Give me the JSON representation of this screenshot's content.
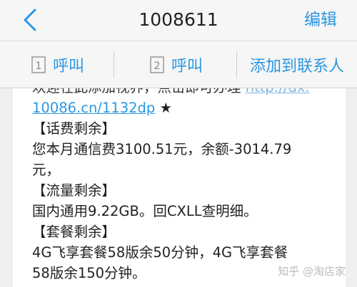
{
  "header": {
    "title": "1008611",
    "edit_label": "编辑"
  },
  "actions": {
    "call1": {
      "sim_number": "1",
      "label": "呼叫"
    },
    "call2": {
      "sim_number": "2",
      "label": "呼叫"
    },
    "add_contact": "添加到联系人"
  },
  "message": {
    "partial_top_text": "欢迎在此添加视界，点击即可办理",
    "partial_top_link": "http://dx.",
    "link_text": "10086.cn/1132dp",
    "star": " ★",
    "lines": [
      "【话费剩余】",
      "您本月通信费3100.51元，余额-3014.79",
      "元，",
      "【流量剩余】",
      "国内通用9.22GB。回CXLL查明细。",
      "【套餐剩余】",
      "4G飞享套餐58版余50分钟，4G飞享套餐",
      "58版余150分钟。"
    ]
  },
  "watermark": "知乎 @淘店家",
  "colors": {
    "accent": "#2b97e0",
    "background": "#efefef",
    "bubble": "#ffffff"
  }
}
